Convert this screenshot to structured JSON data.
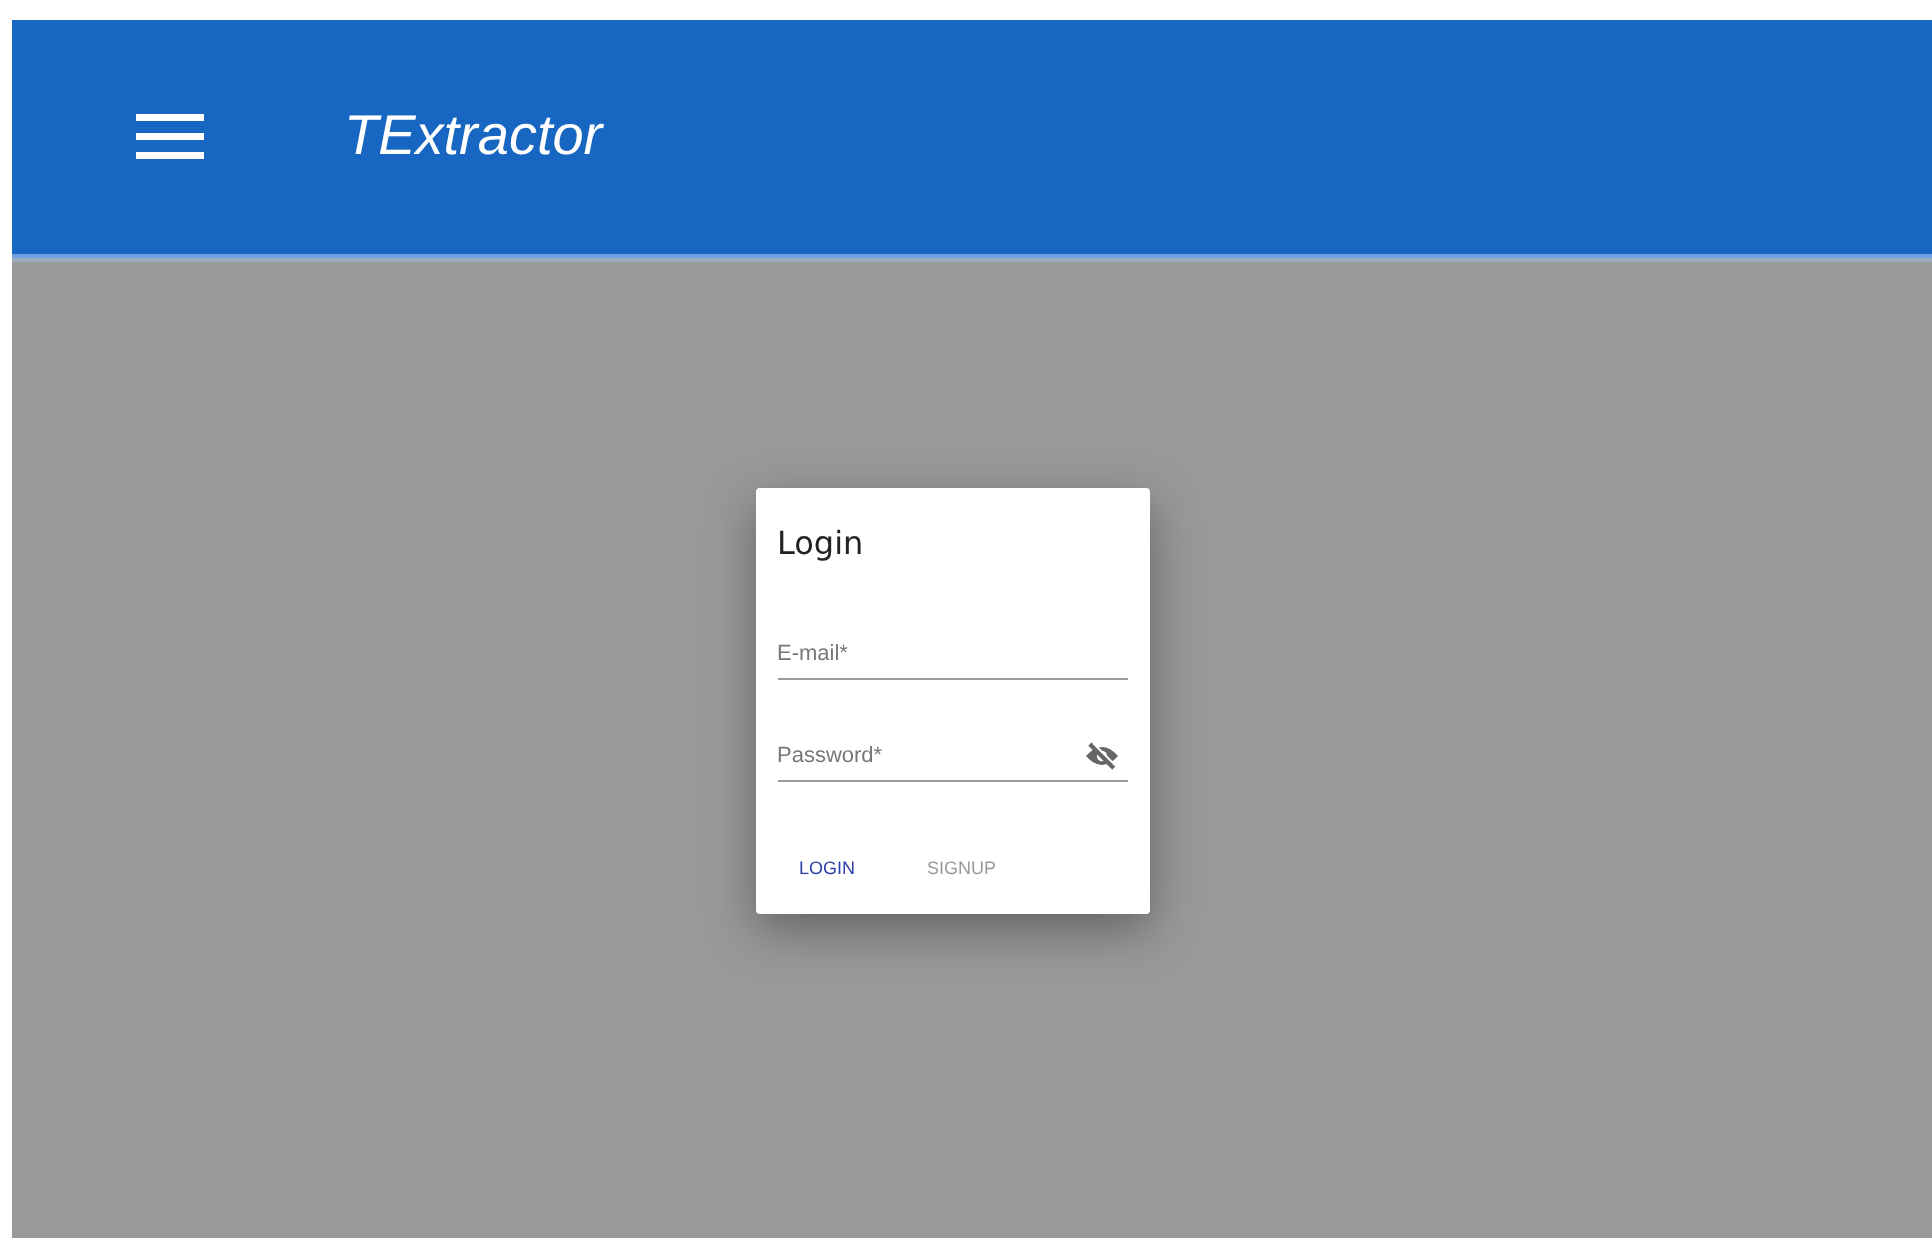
{
  "app_bar": {
    "title": "TExtractor"
  },
  "dialog": {
    "title": "Login",
    "fields": [
      {
        "placeholder": "E-mail*",
        "kind": "text"
      },
      {
        "placeholder": "Password*",
        "kind": "password",
        "visible": false
      }
    ],
    "buttons": [
      {
        "label": "LOGIN",
        "selected": true
      },
      {
        "label": "SIGNUP",
        "selected": false
      }
    ]
  }
}
